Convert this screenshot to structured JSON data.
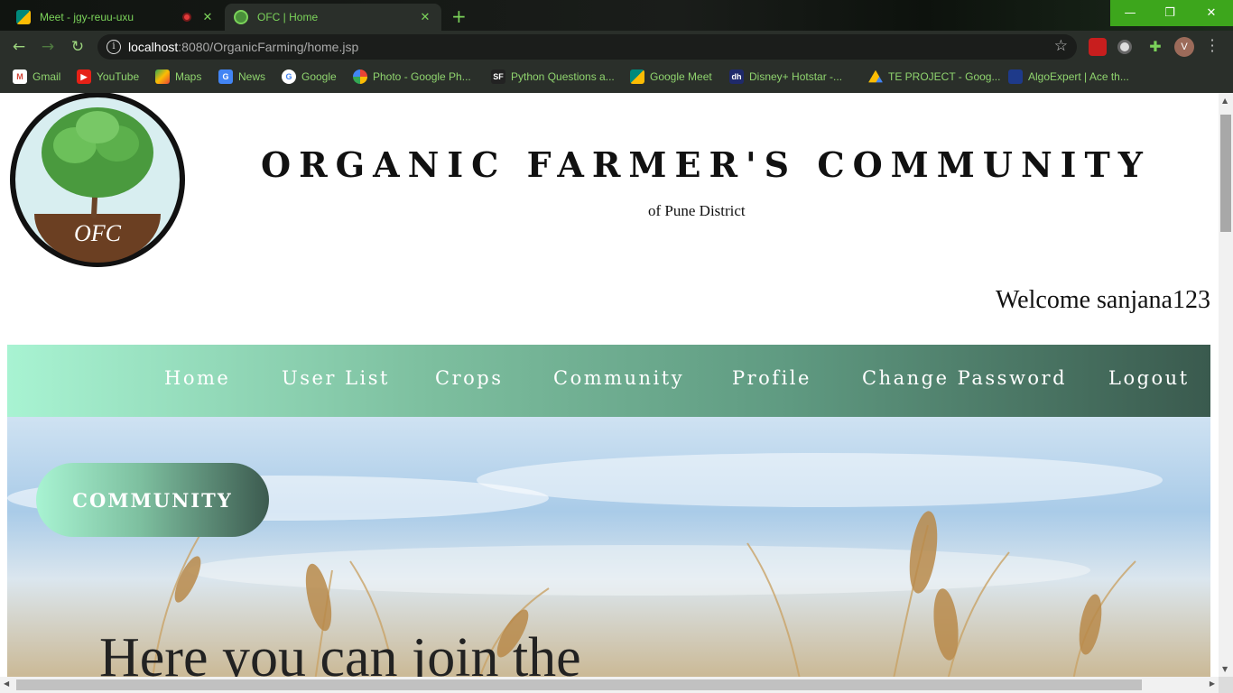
{
  "browser": {
    "tabs": [
      {
        "title": "Meet - jgy-reuu-uxu",
        "icon": "google-meet-icon",
        "recording": true
      },
      {
        "title": "OFC | Home",
        "icon": "globe-icon",
        "active": true
      }
    ],
    "window_controls": {
      "minimize": "—",
      "restore": "❐",
      "close": "✕"
    },
    "address": {
      "host": "localhost",
      "path": ":8080/OrganicFarming/home.jsp"
    },
    "profile_initial": "V",
    "bookmarks": [
      {
        "label": "Gmail",
        "icon": "gmail-icon",
        "color": "#d44638"
      },
      {
        "label": "YouTube",
        "icon": "youtube-icon",
        "color": "#e62117"
      },
      {
        "label": "Maps",
        "icon": "maps-icon",
        "color": "#34a853"
      },
      {
        "label": "News",
        "icon": "news-icon",
        "color": "#4285f4"
      },
      {
        "label": "Google",
        "icon": "google-icon",
        "color": "#ffffff"
      },
      {
        "label": "Photo - Google Ph...",
        "icon": "photos-icon",
        "color": "#fbbc04"
      },
      {
        "label": "Python Questions a...",
        "icon": "sf-icon",
        "color": "#222222"
      },
      {
        "label": "Google Meet",
        "icon": "google-meet-icon",
        "color": "#00897b"
      },
      {
        "label": "Disney+ Hotstar -...",
        "icon": "hotstar-icon",
        "color": "#1f2a6b"
      },
      {
        "label": "TE PROJECT - Goog...",
        "icon": "drive-icon",
        "color": "#fbbc04"
      },
      {
        "label": "AlgoExpert | Ace th...",
        "icon": "algoexpert-icon",
        "color": "#1e3a8a"
      }
    ],
    "accent_color": "#7bd35a"
  },
  "site": {
    "logo_text": "OFC",
    "title": "ORGANIC FARMER'S COMMUNITY",
    "subtitle": "of Pune District",
    "welcome": "Welcome sanjana123",
    "nav": [
      "Home",
      "User List",
      "Crops",
      "Community",
      "Profile",
      "Change Password",
      "Logout"
    ],
    "hero": {
      "button": "COMMUNITY",
      "text": "Here you can join the"
    },
    "colors": {
      "nav_start": "#a8f3d2",
      "nav_end": "#3a5a4e"
    }
  }
}
